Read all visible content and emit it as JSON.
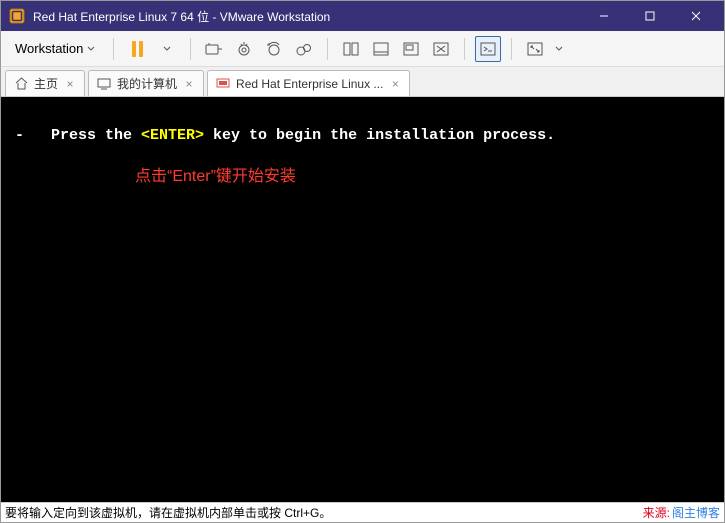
{
  "titlebar": {
    "title": "Red Hat Enterprise Linux 7 64 位 - VMware Workstation"
  },
  "toolbar": {
    "menu_label": "Workstation"
  },
  "tabs": {
    "home": "主页",
    "my_computer": "我的计算机",
    "vm": "Red Hat Enterprise Linux ..."
  },
  "vm": {
    "line_prefix": "-   Press the ",
    "enter": "<ENTER>",
    "line_suffix": " key to begin the installation process.",
    "annotation": "点击“Enter”键开始安装"
  },
  "statusbar": {
    "text": "要将输入定向到该虚拟机，请在虚拟机内部单击或按 Ctrl+G。",
    "watermark_1": "来源:",
    "watermark_2": "阁主博客"
  }
}
